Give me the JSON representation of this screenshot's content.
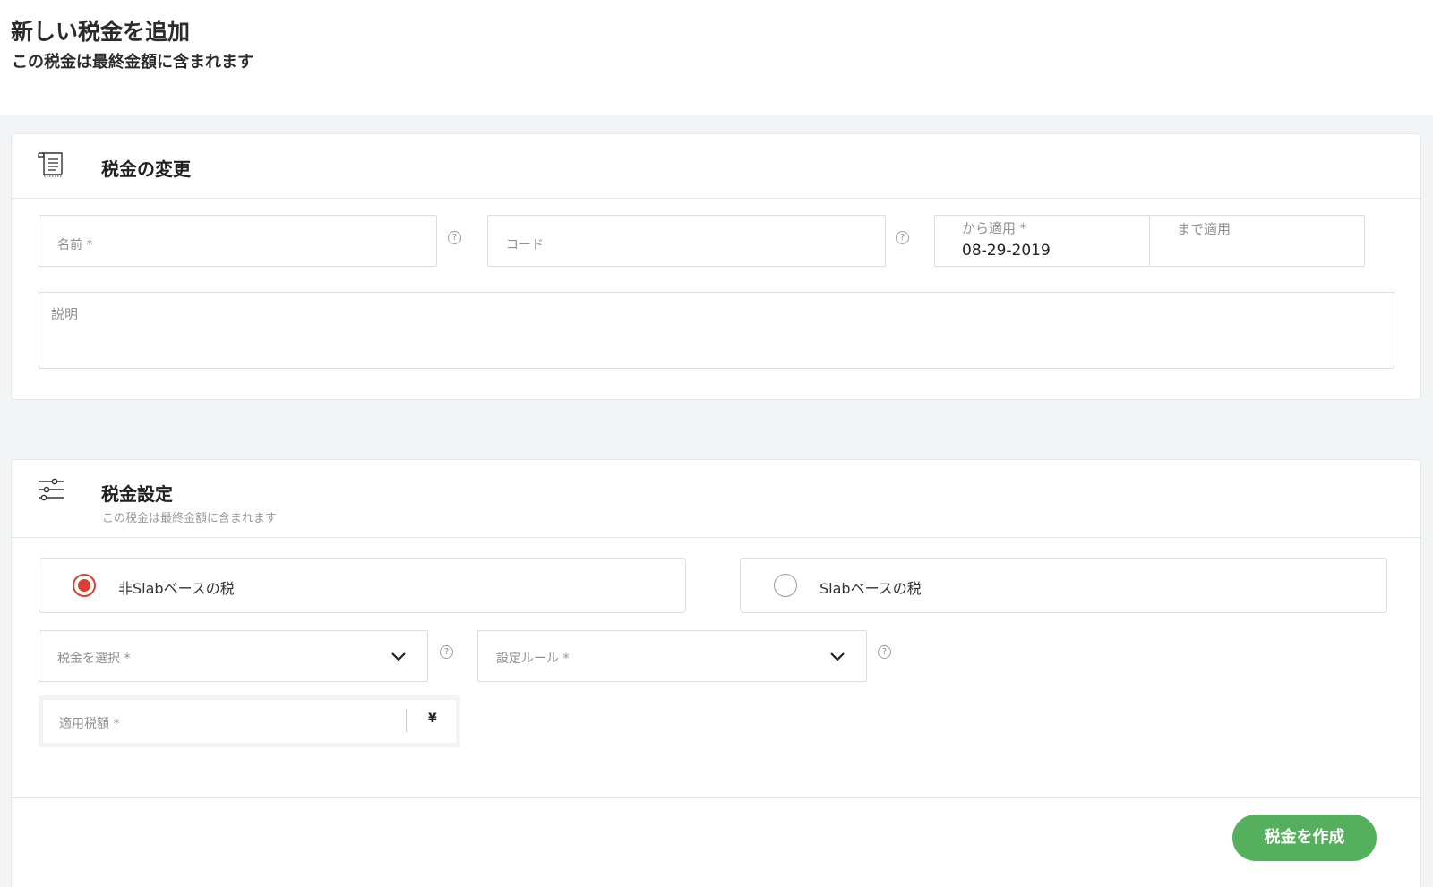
{
  "header": {
    "title": "新しい税金を追加",
    "subtitle": "この税金は最終金額に含まれます"
  },
  "tax_change": {
    "title": "税金の変更",
    "icon": "receipt-icon",
    "name_label": "名前 *",
    "code_label": "コード",
    "from_label": "から適用 *",
    "from_value": "08-29-2019",
    "to_label": "まで適用",
    "description_label": "説明"
  },
  "tax_settings": {
    "title": "税金設定",
    "description": "この税金は最終金額に含まれます",
    "icon": "sliders-icon",
    "options": [
      {
        "label": "非Slabベースの税",
        "selected": true
      },
      {
        "label": "Slabベースの税",
        "selected": false
      }
    ],
    "select_tax_label": "税金を選択 *",
    "setting_rule_label": "設定ルール *",
    "amount_label": "適用税額 *",
    "currency_symbol": "¥"
  },
  "footer": {
    "create_label": "税金を作成"
  },
  "colors": {
    "accent_green": "#55b05d",
    "radio_red": "#d9412f"
  }
}
